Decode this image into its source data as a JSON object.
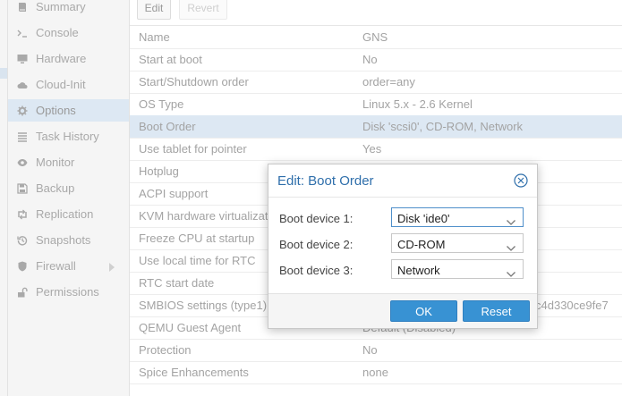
{
  "sidebar": {
    "items": [
      {
        "label": "Summary",
        "icon": "book-icon"
      },
      {
        "label": "Console",
        "icon": "terminal-icon"
      },
      {
        "label": "Hardware",
        "icon": "desktop-icon"
      },
      {
        "label": "Cloud-Init",
        "icon": "cloud-icon"
      },
      {
        "label": "Options",
        "icon": "gear-icon"
      },
      {
        "label": "Task History",
        "icon": "list-icon"
      },
      {
        "label": "Monitor",
        "icon": "eye-icon"
      },
      {
        "label": "Backup",
        "icon": "floppy-icon"
      },
      {
        "label": "Replication",
        "icon": "retweet-icon"
      },
      {
        "label": "Snapshots",
        "icon": "history-icon"
      },
      {
        "label": "Firewall",
        "icon": "shield-icon"
      },
      {
        "label": "Permissions",
        "icon": "unlock-icon"
      }
    ],
    "active": "Options"
  },
  "toolbar": {
    "edit_label": "Edit",
    "revert_label": "Revert"
  },
  "options": {
    "rows": [
      {
        "name": "Name",
        "value": "GNS"
      },
      {
        "name": "Start at boot",
        "value": "No"
      },
      {
        "name": "Start/Shutdown order",
        "value": "order=any"
      },
      {
        "name": "OS Type",
        "value": "Linux 5.x - 2.6 Kernel"
      },
      {
        "name": "Boot Order",
        "value": "Disk 'scsi0', CD-ROM, Network"
      },
      {
        "name": "Use tablet for pointer",
        "value": "Yes"
      },
      {
        "name": "Hotplug",
        "value": ""
      },
      {
        "name": "ACPI support",
        "value": ""
      },
      {
        "name": "KVM hardware virtualizat",
        "value": ""
      },
      {
        "name": "Freeze CPU at startup",
        "value": ""
      },
      {
        "name": "Use local time for RTC",
        "value": ""
      },
      {
        "name": "RTC start date",
        "value": ""
      },
      {
        "name": "SMBIOS settings (type1)",
        "value": "c4d330ce9fe7"
      },
      {
        "name": "QEMU Guest Agent",
        "value": "Default (Disabled)"
      },
      {
        "name": "Protection",
        "value": "No"
      },
      {
        "name": "Spice Enhancements",
        "value": "none"
      }
    ],
    "selected": "Boot Order"
  },
  "dialog": {
    "title": "Edit: Boot Order",
    "fields": [
      {
        "label": "Boot device 1:",
        "value": "Disk 'ide0'"
      },
      {
        "label": "Boot device 2:",
        "value": "CD-ROM"
      },
      {
        "label": "Boot device 3:",
        "value": "Network"
      }
    ],
    "ok_label": "OK",
    "reset_label": "Reset"
  },
  "colors": {
    "accent": "#2f6fab",
    "button": "#3892d3",
    "selection": "#dde8f3"
  }
}
